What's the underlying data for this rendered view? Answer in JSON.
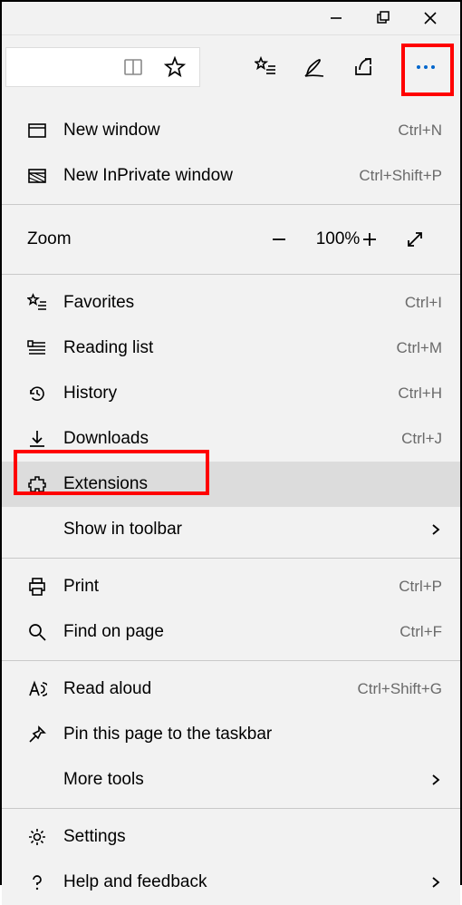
{
  "titlebar": {
    "minimize": "Minimize",
    "maximize": "Maximize",
    "close": "Close"
  },
  "toolbar": {
    "reading_view": "Reading view",
    "favorite_star": "Add to favorites",
    "favorites_list": "Favorites",
    "notes": "Add notes",
    "share": "Share",
    "more": "Settings and more"
  },
  "menu": {
    "new_window": {
      "label": "New window",
      "shortcut": "Ctrl+N"
    },
    "new_inprivate": {
      "label": "New InPrivate window",
      "shortcut": "Ctrl+Shift+P"
    },
    "zoom": {
      "label": "Zoom",
      "value": "100%"
    },
    "favorites": {
      "label": "Favorites",
      "shortcut": "Ctrl+I"
    },
    "reading_list": {
      "label": "Reading list",
      "shortcut": "Ctrl+M"
    },
    "history": {
      "label": "History",
      "shortcut": "Ctrl+H"
    },
    "downloads": {
      "label": "Downloads",
      "shortcut": "Ctrl+J"
    },
    "extensions": {
      "label": "Extensions"
    },
    "show_in_toolbar": {
      "label": "Show in toolbar"
    },
    "print": {
      "label": "Print",
      "shortcut": "Ctrl+P"
    },
    "find": {
      "label": "Find on page",
      "shortcut": "Ctrl+F"
    },
    "read_aloud": {
      "label": "Read aloud",
      "shortcut": "Ctrl+Shift+G"
    },
    "pin": {
      "label": "Pin this page to the taskbar"
    },
    "more_tools": {
      "label": "More tools"
    },
    "settings": {
      "label": "Settings"
    },
    "help": {
      "label": "Help and feedback"
    }
  }
}
